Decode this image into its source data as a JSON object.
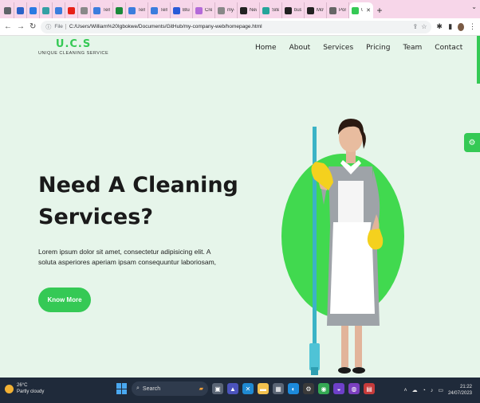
{
  "browser": {
    "tabs": [
      {
        "label": "",
        "icon": "chrome-icon",
        "color": "#5f6368"
      },
      {
        "label": "",
        "icon": "edge-icon",
        "color": "#2b62c8"
      },
      {
        "label": "",
        "icon": "shield-icon",
        "color": "#2a7ae2"
      },
      {
        "label": "",
        "icon": "docs-icon",
        "color": "#34a0a4"
      },
      {
        "label": "",
        "icon": "refresh-icon",
        "color": "#3b7ddd"
      },
      {
        "label": "",
        "icon": "youtube-icon",
        "color": "#e62117"
      },
      {
        "label": "",
        "icon": "link-icon",
        "color": "#888888"
      },
      {
        "label": "Temp",
        "icon": "template-icon",
        "color": "#3b7ddd"
      },
      {
        "label": "",
        "icon": "q-icon",
        "color": "#1b8a3a"
      },
      {
        "label": "Temp",
        "icon": "template-icon",
        "color": "#3b7ddd"
      },
      {
        "label": "Temp",
        "icon": "template-icon",
        "color": "#3b7ddd"
      },
      {
        "label": "Blue",
        "icon": "blue-icon",
        "color": "#2a5bd7"
      },
      {
        "label": "Credit",
        "icon": "wpi-icon",
        "color": "#b36ad9"
      },
      {
        "label": "my-c",
        "icon": "github-icon",
        "color": "#888888"
      },
      {
        "label": "New",
        "icon": "new-icon",
        "color": "#222222"
      },
      {
        "label": "Site c",
        "icon": "netlify-icon",
        "color": "#25a59a"
      },
      {
        "label": "busin",
        "icon": "github-icon",
        "color": "#222222"
      },
      {
        "label": "Movi",
        "icon": "movie-icon",
        "color": "#222222"
      },
      {
        "label": "Portf",
        "icon": "portfolio-icon",
        "color": "#666666"
      }
    ],
    "active_tab_label": "U.",
    "new_tab_label": "+",
    "address_prefix": "File",
    "url": "C:/Users/William%20Igbokwe/Documents/GitHub/my-company-web/homepage.html"
  },
  "site": {
    "logo_title": "U.C.S",
    "logo_subtitle": "UNIQUE CLEANING SERVICE",
    "nav": [
      "Home",
      "About",
      "Services",
      "Pricing",
      "Team",
      "Contact"
    ],
    "headline_line1": "Need A Cleaning",
    "headline_line2": "Services?",
    "lead": "Lorem ipsum dolor sit amet, consectetur adipisicing elit. A soluta asperiores aperiam ipsam consequuntur laboriosam,",
    "cta_label": "Know More",
    "accent_color": "#35c955"
  },
  "taskbar": {
    "weather_temp": "26°C",
    "weather_desc": "Partly cloudy",
    "search_label": "Search",
    "time": "21:22",
    "date": "24/07/2023"
  }
}
